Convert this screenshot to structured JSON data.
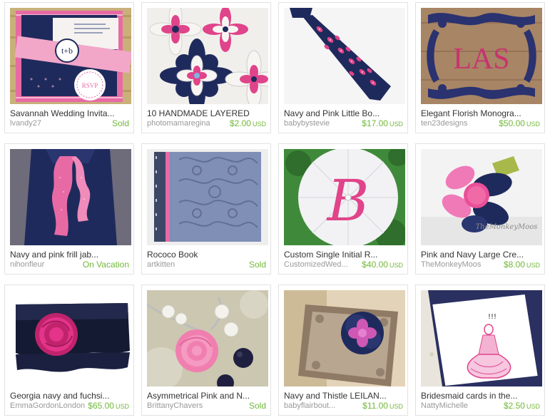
{
  "colors": {
    "price_green": "#72b83a",
    "navy": "#1f2a5c",
    "pink": "#e0448a"
  },
  "items": [
    {
      "title": "Savannah Wedding Invita...",
      "shop": "lvandy27",
      "status": "Sold",
      "price": null,
      "currency": null,
      "image": "invitation-image"
    },
    {
      "title": "10 HANDMADE LAYERED",
      "shop": "photomamaregina",
      "status": null,
      "price": "$2.00",
      "currency": "USD",
      "image": "paper-flowers-image"
    },
    {
      "title": "Navy and Pink Little Bo...",
      "shop": "babybystevie",
      "status": null,
      "price": "$17.00",
      "currency": "USD",
      "image": "necktie-image"
    },
    {
      "title": "Elegant Florish Monogra...",
      "shop": "ten23designs",
      "status": null,
      "price": "$50.00",
      "currency": "USD",
      "image": "monogram-image"
    },
    {
      "title": "Navy and pink frill jab...",
      "shop": "nihonfleur",
      "status": "On Vacation",
      "price": null,
      "currency": null,
      "image": "frill-jabot-image"
    },
    {
      "title": "Rococo Book",
      "shop": "artkitten",
      "status": "Sold",
      "price": null,
      "currency": null,
      "image": "book-image"
    },
    {
      "title": "Custom Single Initial R...",
      "shop": "CustomizedWed...",
      "status": null,
      "price": "$40.00",
      "currency": "USD",
      "image": "parasol-image"
    },
    {
      "title": "Pink and Navy Large Cre...",
      "shop": "TheMonkeyMoos",
      "status": null,
      "price": "$8.00",
      "currency": "USD",
      "image": "fabric-flower-clip-image"
    },
    {
      "title": "Georgia navy and fuchsi...",
      "shop": "EmmaGordonLondon",
      "status": null,
      "price": "$65.00",
      "currency": "USD",
      "image": "clutch-image"
    },
    {
      "title": "Asymmetrical Pink and N...",
      "shop": "BrittanyChavers",
      "status": "Sold",
      "price": null,
      "currency": null,
      "image": "necklace-image"
    },
    {
      "title": "Navy and Thistle LEILAN...",
      "shop": "babyflairbout...",
      "status": null,
      "price": "$11.00",
      "currency": "USD",
      "image": "felt-flower-image"
    },
    {
      "title": "Bridesmaid cards in the...",
      "shop": "NattyMichelle",
      "status": null,
      "price": "$2.50",
      "currency": "USD",
      "image": "bridesmaid-card-image"
    }
  ],
  "image_text": {
    "invite_monogram": "t+b",
    "invite_rsvp": "RSVP",
    "monogram_letters": "LAS",
    "parasol_letter": "B",
    "clip_watermark": "TheMonkeyMoos",
    "card_caption": "!!!"
  }
}
